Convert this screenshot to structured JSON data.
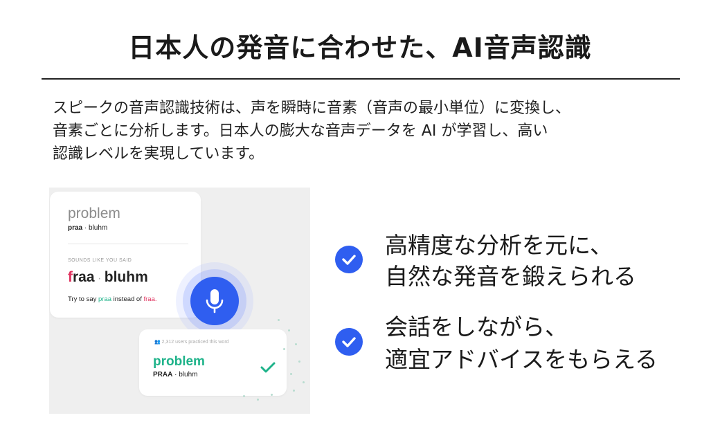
{
  "title": "日本人の発音に合わせた、AI音声認識",
  "description": [
    "スピークの音声認識技術は、声を瞬時に音素（音声の最小単位）に変換し、",
    "音素ごとに分析します。日本人の膨大な音声データを AI が学習し、高い",
    "認識レベルを実現しています。"
  ],
  "illustration": {
    "word": "problem",
    "phonetic_bold": "praa",
    "phonetic_rest": " · bluhm",
    "sounds_label": "SOUNDS LIKE YOU SAID",
    "said_first": "f",
    "said_rest": "raa",
    "said_dot": " · ",
    "said_last": "bluhm",
    "try_prefix": "Try to say ",
    "try_target": "praa",
    "try_middle": " instead of ",
    "try_wrong": "fraa.",
    "users_text": "2,312 users practiced this word",
    "result_word": "problem",
    "result_bold": "PRAA",
    "result_rest": " · bluhm",
    "accent_color": "#2f5ef0",
    "good_color": "#1fb38a",
    "bad_color": "#e0335f"
  },
  "features": [
    {
      "icon": "check-circle-icon",
      "line1": "高精度な分析を元に、",
      "line2": "自然な発音を鍛えられる"
    },
    {
      "icon": "check-circle-icon",
      "line1": "会話をしながら、",
      "line2": "適宜アドバイスをもらえる"
    }
  ]
}
